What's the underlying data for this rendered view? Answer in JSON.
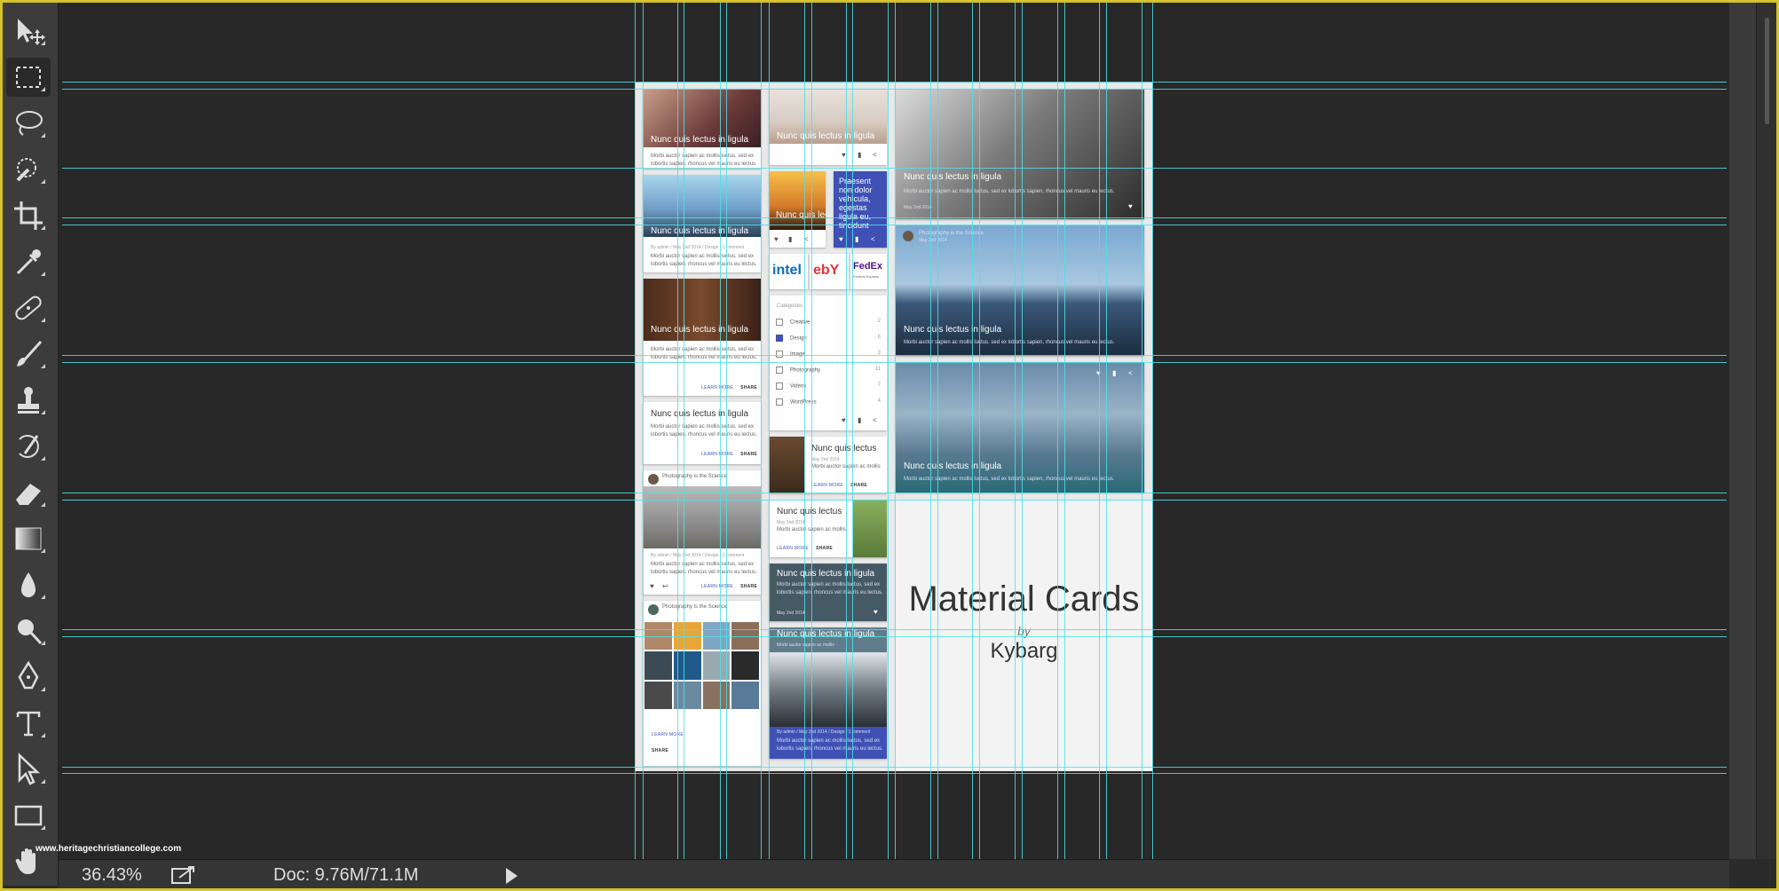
{
  "app": {
    "zoom": "36.43%",
    "doc_info": "Doc: 9.76M/71.1M",
    "watermark": "www.heritagechristiancollege.com"
  },
  "tools": [
    {
      "name": "move-tool-icon"
    },
    {
      "name": "marquee-tool-icon",
      "active": true
    },
    {
      "name": "lasso-tool-icon"
    },
    {
      "name": "quick-selection-tool-icon"
    },
    {
      "name": "crop-tool-icon"
    },
    {
      "name": "eyedropper-tool-icon"
    },
    {
      "name": "healing-brush-tool-icon"
    },
    {
      "name": "brush-tool-icon"
    },
    {
      "name": "clone-stamp-tool-icon"
    },
    {
      "name": "history-brush-tool-icon"
    },
    {
      "name": "eraser-tool-icon"
    },
    {
      "name": "gradient-tool-icon"
    },
    {
      "name": "blur-tool-icon"
    },
    {
      "name": "dodge-tool-icon"
    },
    {
      "name": "pen-tool-icon"
    },
    {
      "name": "type-tool-icon"
    },
    {
      "name": "path-selection-tool-icon"
    },
    {
      "name": "rectangle-tool-icon"
    },
    {
      "name": "hand-tool-icon"
    }
  ],
  "design": {
    "card_title": "Nunc quis lectus in ligula",
    "card_title_short": "Nunc quis lectus",
    "card_body": "Morbi auctor sapien ac mollis luctus, sed ex lobortis sapien, rhoncus vel mauris eu lectus.",
    "card_body_short": "Morbi auctor sapien ac mollis",
    "learn_more": "LEARN MORE",
    "share": "SHARE",
    "meta_line": "By admin / May 2nd 2014 / Design / 1 comment",
    "date": "May 2nd 2014",
    "profile_name": "Photography is the Science",
    "blue_card_text": "Praesent non dolor vehicula, egestas ligula eu, tincidunt",
    "logos": [
      "intel",
      "ebY",
      "FedEx"
    ],
    "fedex_sub": "Federal Express",
    "categories_label": "Categories",
    "categories": [
      {
        "label": "Creative",
        "count": "2",
        "checked": false
      },
      {
        "label": "Design",
        "count": "6",
        "checked": true
      },
      {
        "label": "Image",
        "count": "3",
        "checked": false
      },
      {
        "label": "Photography",
        "count": "11",
        "checked": false
      },
      {
        "label": "Videos",
        "count": "7",
        "checked": false
      },
      {
        "label": "WordPress",
        "count": "4",
        "checked": false
      }
    ],
    "title": "Material Cards",
    "by": "by",
    "author": "Kybarg"
  },
  "colors": {
    "accent_blue": "#3f51b5",
    "guide_cyan": "#4fe0e6",
    "frame_yellow": "#d6c22c",
    "slate_card": "#455a64"
  }
}
